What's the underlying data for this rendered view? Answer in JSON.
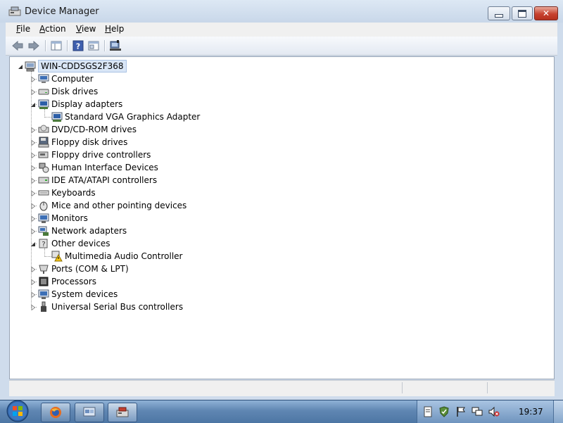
{
  "window": {
    "title": "Device Manager"
  },
  "menu": {
    "items": [
      {
        "label": "File",
        "underline": "F"
      },
      {
        "label": "Action",
        "underline": "A"
      },
      {
        "label": "View",
        "underline": "V"
      },
      {
        "label": "Help",
        "underline": "H"
      }
    ]
  },
  "toolbar": {
    "buttons": [
      "back-arrow-icon",
      "forward-arrow-icon",
      "show-hide-console-tree-icon",
      "help-icon",
      "properties-icon",
      "scan-hardware-icon"
    ]
  },
  "tree": {
    "root": "WIN-CDDSGS2F368",
    "categories": [
      {
        "label": "Computer",
        "icon": "computer-icon",
        "expanded": false
      },
      {
        "label": "Disk drives",
        "icon": "disk-drive-icon",
        "expanded": false
      },
      {
        "label": "Display adapters",
        "icon": "display-adapter-icon",
        "expanded": true
      },
      {
        "label": "Standard VGA Graphics Adapter",
        "icon": "display-adapter-icon",
        "child": true
      },
      {
        "label": "DVD/CD-ROM drives",
        "icon": "dvd-drive-icon",
        "expanded": false
      },
      {
        "label": "Floppy disk drives",
        "icon": "floppy-icon",
        "expanded": false
      },
      {
        "label": "Floppy drive controllers",
        "icon": "floppy-controller-icon",
        "expanded": false
      },
      {
        "label": "Human Interface Devices",
        "icon": "hid-icon",
        "expanded": false
      },
      {
        "label": "IDE ATA/ATAPI controllers",
        "icon": "ide-controller-icon",
        "expanded": false
      },
      {
        "label": "Keyboards",
        "icon": "keyboard-icon",
        "expanded": false
      },
      {
        "label": "Mice and other pointing devices",
        "icon": "mouse-icon",
        "expanded": false
      },
      {
        "label": "Monitors",
        "icon": "monitor-icon",
        "expanded": false
      },
      {
        "label": "Network adapters",
        "icon": "network-adapter-icon",
        "expanded": false
      },
      {
        "label": "Other devices",
        "icon": "other-devices-icon",
        "expanded": true
      },
      {
        "label": "Multimedia Audio Controller",
        "icon": "warning-device-icon",
        "child": true
      },
      {
        "label": "Ports (COM & LPT)",
        "icon": "port-icon",
        "expanded": false
      },
      {
        "label": "Processors",
        "icon": "processor-icon",
        "expanded": false
      },
      {
        "label": "System devices",
        "icon": "system-device-icon",
        "expanded": false
      },
      {
        "label": "Universal Serial Bus controllers",
        "icon": "usb-icon",
        "expanded": false
      }
    ]
  },
  "taskbar": {
    "clock": "19:37",
    "buttons": [
      "firefox-icon",
      "network-window-icon",
      "device-manager-taskbar-icon"
    ]
  },
  "colors": {
    "selection": "#d9e6f6",
    "taskbar": "#5f86b2",
    "close": "#c7422f"
  }
}
